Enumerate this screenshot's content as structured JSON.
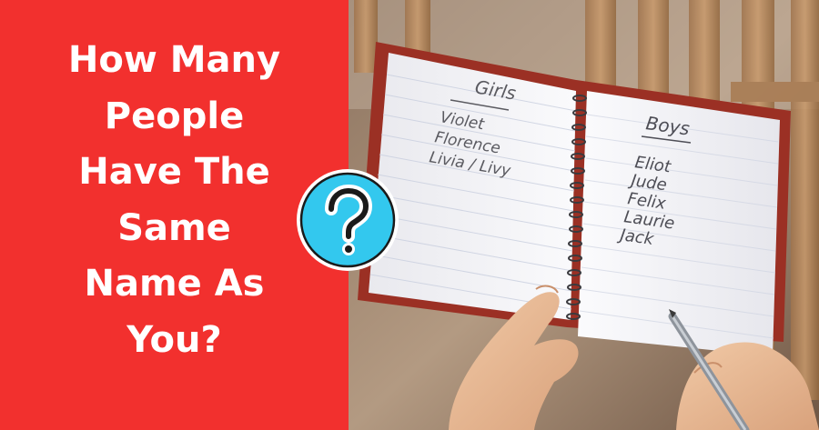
{
  "headline": {
    "lines": [
      "How Many",
      "People",
      "Have The",
      "Same",
      "Name As",
      "You?"
    ]
  },
  "badge": {
    "symbol": "?",
    "icon": "question-mark-icon"
  },
  "notebook": {
    "girls_heading": "Girls",
    "girls_names": [
      "Violet",
      "Florence",
      "Livia / Livy"
    ],
    "boys_heading": "Boys",
    "boys_names": [
      "Eliot",
      "Jude",
      "Felix",
      "Laurie",
      "Jack"
    ]
  },
  "colors": {
    "panel_red": "#f2302e",
    "headline_text": "#ffffff",
    "badge_fill": "#33c8ee",
    "badge_ring": "#ffffff"
  }
}
